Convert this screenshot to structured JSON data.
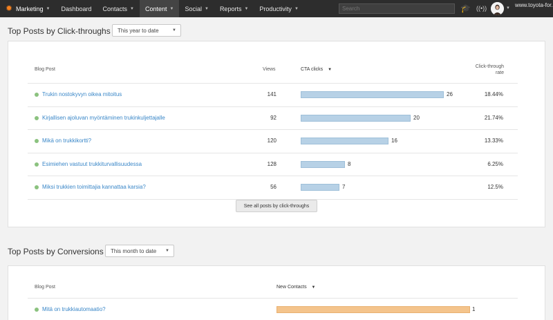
{
  "nav": {
    "brand": "Marketing",
    "items": [
      "Dashboard",
      "Contacts",
      "Content",
      "Social",
      "Reports",
      "Productivity"
    ],
    "active": "Content",
    "search_placeholder": "Search",
    "account": "www.toyota-for..."
  },
  "section1": {
    "title": "Top Posts by Click-throughs",
    "range": "This year to date",
    "columns": {
      "post": "Blog Post",
      "views": "Views",
      "cta": "CTA clicks",
      "rate_line1": "Click-through",
      "rate_line2": "rate"
    },
    "rows": [
      {
        "title": "Trukin nostokyvyn oikea mitoitus",
        "views": "141",
        "cta": 26,
        "cta_label": "26",
        "rate": "18.44%"
      },
      {
        "title": "Kirjallisen ajoluvan myöntäminen trukinkuljettajalle",
        "views": "92",
        "cta": 20,
        "cta_label": "20",
        "rate": "21.74%"
      },
      {
        "title": "Mikä on trukkikortti?",
        "views": "120",
        "cta": 16,
        "cta_label": "16",
        "rate": "13.33%"
      },
      {
        "title": "Esimiehen vastuut trukkiturvallisuudessa",
        "views": "128",
        "cta": 8,
        "cta_label": "8",
        "rate": "6.25%"
      },
      {
        "title": "Miksi trukkien toimittajia kannattaa karsia?",
        "views": "56",
        "cta": 7,
        "cta_label": "7",
        "rate": "12.5%"
      }
    ],
    "button": "See all posts by click-throughs"
  },
  "section2": {
    "title": "Top Posts by Conversions",
    "range": "This month to date",
    "columns": {
      "post": "Blog Post",
      "contacts": "New Contacts"
    },
    "rows": [
      {
        "title": "Mitä on trukkiautomaatio?",
        "contacts": 1,
        "contacts_label": "1"
      }
    ]
  },
  "colors": {
    "nav_bg": "#2d2d2d",
    "link": "#3a87c8",
    "bar_blue": "#b7d1e6",
    "bar_orange": "#f4c48c",
    "dot_green": "#8bc27f"
  }
}
